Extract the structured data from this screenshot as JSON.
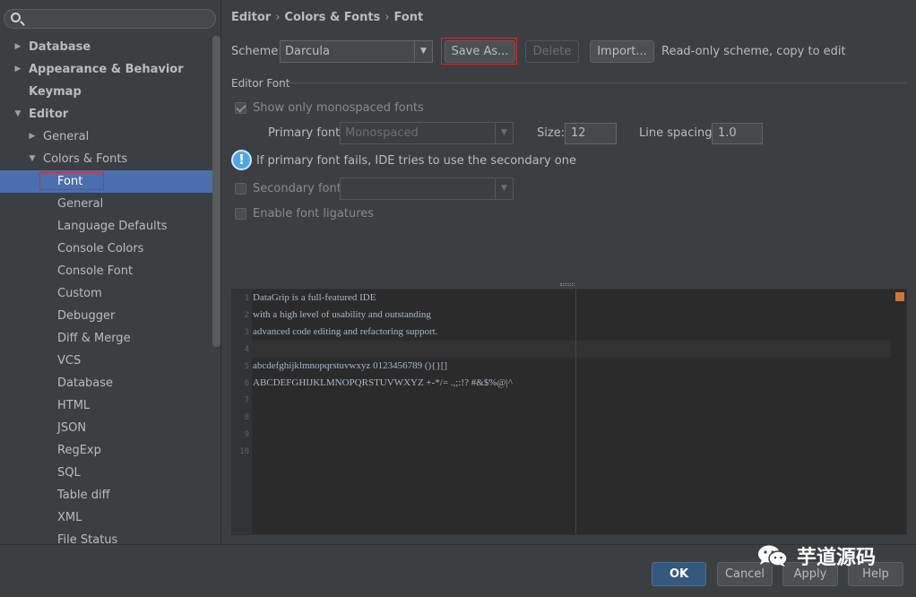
{
  "search": {
    "placeholder": ""
  },
  "tree": [
    {
      "label": "Database",
      "level": 0,
      "arrow": "right",
      "bold": true
    },
    {
      "label": "Appearance & Behavior",
      "level": 0,
      "arrow": "right",
      "bold": true
    },
    {
      "label": "Keymap",
      "level": 0,
      "arrow": "",
      "bold": true
    },
    {
      "label": "Editor",
      "level": 0,
      "arrow": "down",
      "bold": true
    },
    {
      "label": "General",
      "level": 1,
      "arrow": "right"
    },
    {
      "label": "Colors & Fonts",
      "level": 1,
      "arrow": "down"
    },
    {
      "label": "Font",
      "level": 2,
      "selected": true
    },
    {
      "label": "General",
      "level": 2
    },
    {
      "label": "Language Defaults",
      "level": 2
    },
    {
      "label": "Console Colors",
      "level": 2
    },
    {
      "label": "Console Font",
      "level": 2
    },
    {
      "label": "Custom",
      "level": 2
    },
    {
      "label": "Debugger",
      "level": 2
    },
    {
      "label": "Diff & Merge",
      "level": 2
    },
    {
      "label": "VCS",
      "level": 2
    },
    {
      "label": "Database",
      "level": 2
    },
    {
      "label": "HTML",
      "level": 2
    },
    {
      "label": "JSON",
      "level": 2
    },
    {
      "label": "RegExp",
      "level": 2
    },
    {
      "label": "SQL",
      "level": 2
    },
    {
      "label": "Table diff",
      "level": 2
    },
    {
      "label": "XML",
      "level": 2
    },
    {
      "label": "File Status",
      "level": 2
    }
  ],
  "breadcrumb": {
    "part1": "Editor",
    "part2": "Colors & Fonts",
    "part3": "Font",
    "sep": "›"
  },
  "scheme": {
    "label": "Scheme:",
    "value": "Darcula",
    "save_as": "Save As...",
    "delete": "Delete",
    "import": "Import...",
    "note": "Read-only scheme, copy to edit"
  },
  "editor_font": {
    "section_title": "Editor Font",
    "monospaced_label": "Show only monospaced fonts",
    "primary_label": "Primary font:",
    "primary_value": "Monospaced",
    "size_label": "Size:",
    "size_value": "12",
    "spacing_label": "Line spacing:",
    "spacing_value": "1.0",
    "info_text": "If primary font fails, IDE tries to use the secondary one",
    "secondary_label": "Secondary font:",
    "secondary_value": "",
    "ligatures_label": "Enable font ligatures"
  },
  "preview": {
    "line_numbers": [
      "1",
      "2",
      "3",
      "4",
      "5",
      "6",
      "7",
      "8",
      "9",
      "10"
    ],
    "lines": [
      "DataGrip is a full-featured IDE",
      "with a high level of usability and outstanding",
      "advanced code editing and refactoring support.",
      "",
      "abcdefghijklmnopqrstuvwxyz 0123456789 (){}[]",
      "ABCDEFGHIJKLMNOPQRSTUVWXYZ +-*/= .,;:!? #&$%@|^"
    ]
  },
  "footer": {
    "ok": "OK",
    "cancel": "Cancel",
    "apply": "Apply",
    "help": "Help"
  },
  "watermark": {
    "text": "芋道源码"
  },
  "colors": {
    "selection": "#4b6eaf",
    "background": "#3c3f41",
    "editor_bg": "#2b2b2b",
    "highlight_border": "#e0262a"
  }
}
